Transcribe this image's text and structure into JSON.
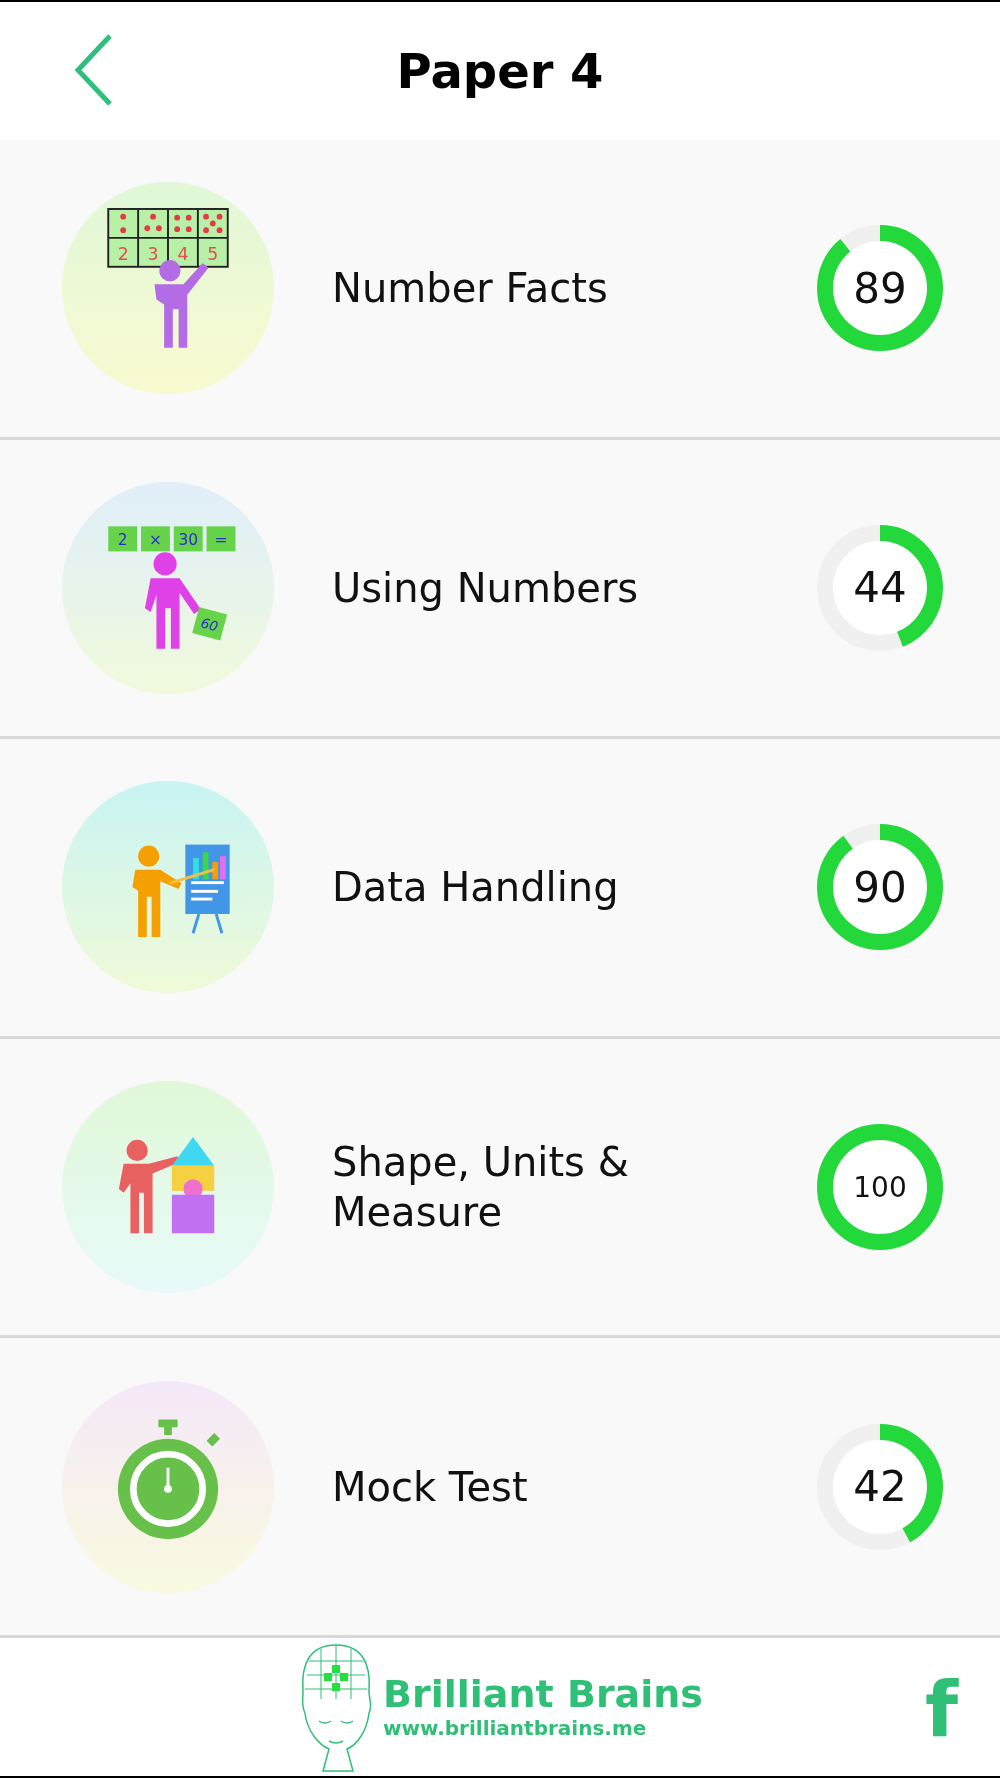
{
  "header": {
    "title": "Paper 4"
  },
  "topics": [
    {
      "kind": "board",
      "label": "Number Facts",
      "score": "89",
      "level": 0.89,
      "icon_labels": [
        "2",
        "3",
        "4",
        "5"
      ]
    },
    {
      "kind": "equation",
      "label": "Using Numbers",
      "score": "44",
      "level": 0.44,
      "icon_labels": [
        "2",
        "×",
        "30",
        "=",
        "60"
      ]
    },
    {
      "kind": "chart",
      "label": "Data Handling",
      "score": "90",
      "level": 0.9
    },
    {
      "kind": "blocks",
      "label": "Shape, Units & Measure",
      "score": "100",
      "level": 1
    },
    {
      "kind": "stopwatch",
      "label": "Mock Test",
      "score": "42",
      "level": 0.42
    }
  ],
  "footer": {
    "brand": "Brilliant Brains",
    "url": "www.brilliantbrains.me",
    "social": "f"
  }
}
